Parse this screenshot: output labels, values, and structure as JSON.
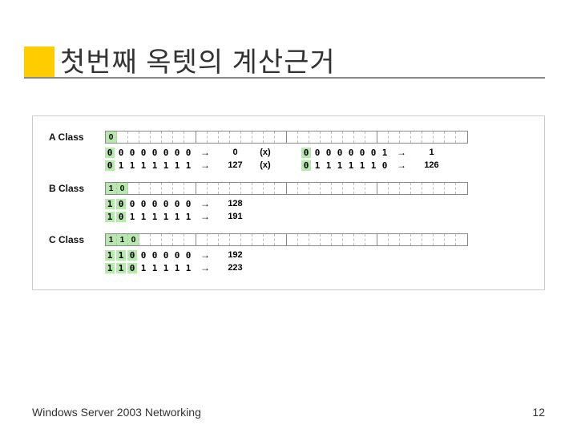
{
  "title": "첫번째 옥텟의 계산근거",
  "footer_left": "Windows Server 2003 Networking",
  "footer_right": "12",
  "chart_data": {
    "type": "table",
    "title": "First octet calculation basis by IP class",
    "classes": [
      {
        "name": "A Class",
        "fixed_bits": [
          "0"
        ],
        "calcs": [
          {
            "bits": [
              "0",
              "0",
              "0",
              "0",
              "0",
              "0",
              "0",
              "0"
            ],
            "result": "0",
            "note": "(x)"
          },
          {
            "bits_alt": [
              "0",
              "0",
              "0",
              "0",
              "0",
              "0",
              "0",
              "1"
            ],
            "result_alt": "1"
          },
          {
            "bits": [
              "0",
              "1",
              "1",
              "1",
              "1",
              "1",
              "1",
              "1"
            ],
            "result": "127",
            "note": "(x)"
          },
          {
            "bits_alt": [
              "0",
              "1",
              "1",
              "1",
              "1",
              "1",
              "1",
              "0"
            ],
            "result_alt": "126"
          }
        ],
        "range_valid": [
          1,
          126
        ]
      },
      {
        "name": "B Class",
        "fixed_bits": [
          "1",
          "0"
        ],
        "calcs": [
          {
            "bits": [
              "1",
              "0",
              "0",
              "0",
              "0",
              "0",
              "0",
              "0"
            ],
            "result": "128"
          },
          {
            "bits": [
              "1",
              "0",
              "1",
              "1",
              "1",
              "1",
              "1",
              "1"
            ],
            "result": "191"
          }
        ],
        "range_valid": [
          128,
          191
        ]
      },
      {
        "name": "C Class",
        "fixed_bits": [
          "1",
          "1",
          "0"
        ],
        "calcs": [
          {
            "bits": [
              "1",
              "1",
              "0",
              "0",
              "0",
              "0",
              "0",
              "0"
            ],
            "result": "192"
          },
          {
            "bits": [
              "1",
              "1",
              "0",
              "1",
              "1",
              "1",
              "1",
              "1"
            ],
            "result": "223"
          }
        ],
        "range_valid": [
          192,
          223
        ]
      }
    ]
  },
  "labels": {
    "a": "A Class",
    "b": "B Class",
    "c": "C Class"
  },
  "a_calc1": {
    "b0": "0",
    "b1": "0",
    "b2": "0",
    "b3": "0",
    "b4": "0",
    "b5": "0",
    "b6": "0",
    "b7": "0",
    "arrow": "→",
    "res": "0",
    "note": "(x)",
    "ab0": "0",
    "ab1": "0",
    "ab2": "0",
    "ab3": "0",
    "ab4": "0",
    "ab5": "0",
    "ab6": "0",
    "ab7": "1",
    "ares": "1"
  },
  "a_calc2": {
    "b0": "0",
    "b1": "1",
    "b2": "1",
    "b3": "1",
    "b4": "1",
    "b5": "1",
    "b6": "1",
    "b7": "1",
    "arrow": "→",
    "res": "127",
    "note": "(x)",
    "ab0": "0",
    "ab1": "1",
    "ab2": "1",
    "ab3": "1",
    "ab4": "1",
    "ab5": "1",
    "ab6": "1",
    "ab7": "0",
    "ares": "126"
  },
  "b_calc1": {
    "b0": "1",
    "b1": "0",
    "b2": "0",
    "b3": "0",
    "b4": "0",
    "b5": "0",
    "b6": "0",
    "b7": "0",
    "arrow": "→",
    "res": "128"
  },
  "b_calc2": {
    "b0": "1",
    "b1": "0",
    "b2": "1",
    "b3": "1",
    "b4": "1",
    "b5": "1",
    "b6": "1",
    "b7": "1",
    "arrow": "→",
    "res": "191"
  },
  "c_calc1": {
    "b0": "1",
    "b1": "1",
    "b2": "0",
    "b3": "0",
    "b4": "0",
    "b5": "0",
    "b6": "0",
    "b7": "0",
    "arrow": "→",
    "res": "192"
  },
  "c_calc2": {
    "b0": "1",
    "b1": "1",
    "b2": "0",
    "b3": "1",
    "b4": "1",
    "b5": "1",
    "b6": "1",
    "b7": "1",
    "arrow": "→",
    "res": "223"
  },
  "fixed": {
    "a0": "0",
    "b0": "1",
    "b1": "0",
    "c0": "1",
    "c1": "1",
    "c2": "0"
  }
}
